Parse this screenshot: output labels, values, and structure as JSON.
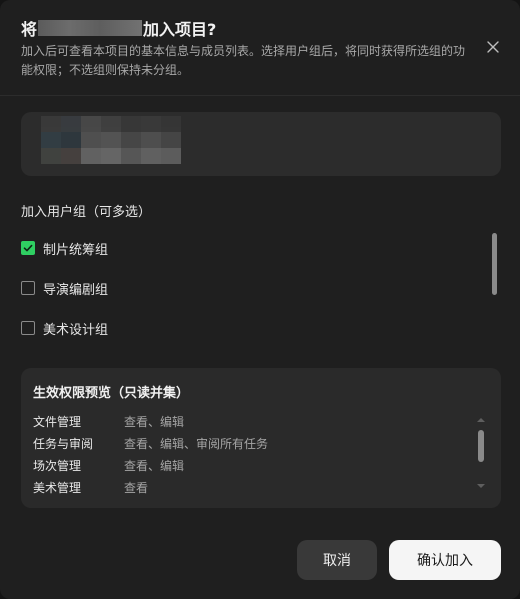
{
  "dialog": {
    "title_prefix": "将",
    "title_suffix": "加入项目?",
    "subtitle": "加入后可查看本项目的基本信息与成员列表。选择用户组后，将同时获得所选组的功能权限；不选组则保持未分组。",
    "close_icon": "close-icon"
  },
  "groups": {
    "label": "加入用户组（可多选）",
    "items": [
      {
        "label": "制片统筹组",
        "checked": true
      },
      {
        "label": "导演编剧组",
        "checked": false
      },
      {
        "label": "美术设计组",
        "checked": false
      }
    ]
  },
  "preview": {
    "title": "生效权限预览（只读并集）",
    "rows": [
      {
        "name": "文件管理",
        "value": "查看、编辑"
      },
      {
        "name": "任务与审阅",
        "value": "查看、编辑、审阅所有任务"
      },
      {
        "name": "场次管理",
        "value": "查看、编辑"
      },
      {
        "name": "美术管理",
        "value": "查看"
      }
    ]
  },
  "buttons": {
    "cancel": "取消",
    "confirm": "确认加入"
  },
  "colors": {
    "accent_check": "#2fcf62",
    "dialog_bg": "#1f1f1f"
  }
}
